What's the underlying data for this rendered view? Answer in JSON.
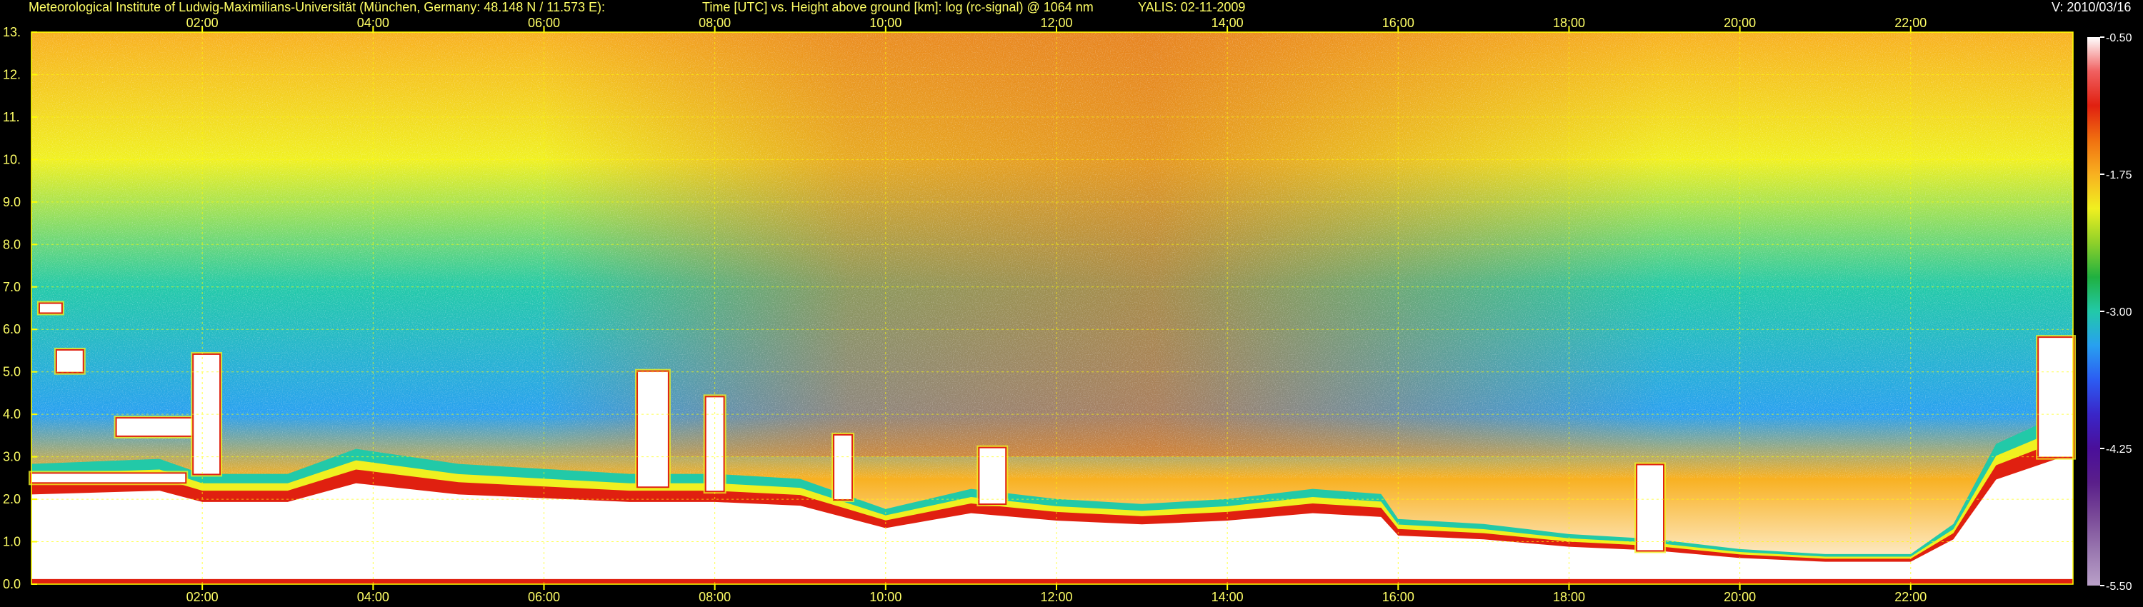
{
  "header": {
    "institute": "Meteorological Institute of Ludwig-Maximilians-Universität (München, Germany: 48.148 N / 11.573 E):",
    "axis_desc": "Time [UTC] vs. Height above ground [km]: log (rc-signal) @ 1064 nm",
    "instrument_date": "YALIS: 02-11-2009",
    "version": "V: 2010/03/16"
  },
  "colors": {
    "background": "#000000",
    "header_text": "#ffff66",
    "grid": "#ffff00",
    "colorbar": [
      "#b9a0c8",
      "#9a78b0",
      "#7a4a98",
      "#5a1f8a",
      "#4a0f9a",
      "#3a26c8",
      "#2c5cf2",
      "#28a0f0",
      "#22c9a8",
      "#20b040",
      "#8fd02a",
      "#f0f020",
      "#f8b020",
      "#f07010",
      "#e02010",
      "#f06060",
      "#ffffff"
    ]
  },
  "chart_data": {
    "type": "heatmap",
    "title": "Time [UTC] vs. Height above ground [km]: log (rc-signal) @ 1064 nm",
    "xlabel": "Time [UTC]",
    "ylabel": "Height above ground [km]",
    "xlim_hours": [
      0.0,
      23.9
    ],
    "ylim": [
      0,
      13
    ],
    "x_ticks": [
      "02:00",
      "04:00",
      "06:00",
      "08:00",
      "10:00",
      "12:00",
      "14:00",
      "16:00",
      "18:00",
      "20:00",
      "22:00"
    ],
    "x_tick_hours": [
      2,
      4,
      6,
      8,
      10,
      12,
      14,
      16,
      18,
      20,
      22
    ],
    "y_ticks": [
      "0.0",
      "1.0",
      "2.0",
      "3.0",
      "4.0",
      "5.0",
      "6.0",
      "7.0",
      "8.0",
      "9.0",
      "10.",
      "11.",
      "12.",
      "13."
    ],
    "y_tick_values": [
      0,
      1,
      2,
      3,
      4,
      5,
      6,
      7,
      8,
      9,
      10,
      11,
      12,
      13
    ],
    "colorbar": {
      "range": [
        -5.5,
        -0.5
      ],
      "ticks": [
        "-0.50",
        "-1.75",
        "-3.00",
        "-4.25",
        "-5.50"
      ],
      "tick_values": [
        -0.5,
        -1.75,
        -3.0,
        -4.25,
        -5.5
      ]
    },
    "grid": true,
    "boundary_layer_top_km": [
      [
        0.0,
        2.4
      ],
      [
        1.5,
        2.5
      ],
      [
        2.0,
        2.2
      ],
      [
        3.0,
        2.2
      ],
      [
        3.8,
        2.7
      ],
      [
        5.0,
        2.4
      ],
      [
        6.0,
        2.3
      ],
      [
        7.0,
        2.2
      ],
      [
        8.0,
        2.2
      ],
      [
        9.0,
        2.1
      ],
      [
        10.0,
        1.5
      ],
      [
        10.5,
        1.7
      ],
      [
        11.0,
        1.9
      ],
      [
        12.0,
        1.7
      ],
      [
        13.0,
        1.6
      ],
      [
        14.0,
        1.7
      ],
      [
        15.0,
        1.9
      ],
      [
        15.8,
        1.8
      ],
      [
        16.0,
        1.3
      ],
      [
        17.0,
        1.2
      ],
      [
        18.0,
        1.0
      ],
      [
        19.0,
        0.9
      ],
      [
        20.0,
        0.7
      ],
      [
        21.0,
        0.6
      ],
      [
        22.0,
        0.6
      ],
      [
        22.5,
        1.2
      ],
      [
        23.0,
        2.8
      ],
      [
        23.9,
        3.5
      ]
    ],
    "cloud_layers": [
      {
        "t_start": 0.1,
        "t_end": 0.35,
        "base_km": 6.4,
        "top_km": 6.6
      },
      {
        "t_start": 0.3,
        "t_end": 0.6,
        "base_km": 5.0,
        "top_km": 5.5
      },
      {
        "t_start": 0.0,
        "t_end": 1.8,
        "base_km": 2.4,
        "top_km": 2.6
      },
      {
        "t_start": 1.0,
        "t_end": 2.0,
        "base_km": 3.5,
        "top_km": 3.9
      },
      {
        "t_start": 1.9,
        "t_end": 2.2,
        "base_km": 2.6,
        "top_km": 5.4
      },
      {
        "t_start": 7.1,
        "t_end": 7.45,
        "base_km": 2.3,
        "top_km": 5.0
      },
      {
        "t_start": 7.9,
        "t_end": 8.1,
        "base_km": 2.2,
        "top_km": 4.4
      },
      {
        "t_start": 9.4,
        "t_end": 9.6,
        "base_km": 2.0,
        "top_km": 3.5
      },
      {
        "t_start": 11.1,
        "t_end": 11.4,
        "base_km": 1.9,
        "top_km": 3.2
      },
      {
        "t_start": 18.8,
        "t_end": 19.1,
        "base_km": 0.8,
        "top_km": 2.8
      },
      {
        "t_start": 23.5,
        "t_end": 23.9,
        "base_km": 3.0,
        "top_km": 5.8
      }
    ],
    "profile_bands_log10": [
      {
        "z_km": 0.0,
        "value": -0.6
      },
      {
        "z_km": 2.5,
        "value": -1.6
      },
      {
        "z_km": 4.0,
        "value": -3.3
      },
      {
        "z_km": 7.0,
        "value": -2.9
      },
      {
        "z_km": 10.0,
        "value": -2.2
      },
      {
        "z_km": 13.0,
        "value": -1.8
      }
    ]
  }
}
